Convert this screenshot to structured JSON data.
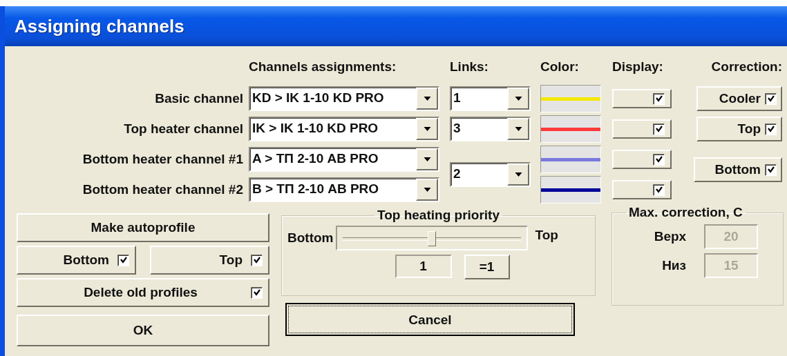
{
  "window": {
    "title": "Assigning channels"
  },
  "headers": {
    "assignments": "Channels assignments:",
    "links": "Links:",
    "colour_column": "Color:",
    "display": "Display:",
    "correction": "Correction:"
  },
  "channels": [
    {
      "label": "Basic channel",
      "assignment": "KD > IK 1-10 KD PRO",
      "color": "#f5e800",
      "display": true
    },
    {
      "label": "Top heater channel",
      "assignment": "IK > IK 1-10 KD PRO",
      "color": "#ff3a3a",
      "display": true
    },
    {
      "label": "Bottom heater channel #1",
      "assignment": "A > ТП 2-10 AB PRO",
      "color": "#7a7ae0",
      "display": true
    },
    {
      "label": "Bottom heater channel #2",
      "assignment": "B > ТП 2-10 AB PRO",
      "color": "#000099",
      "display": true
    }
  ],
  "links": [
    {
      "value": "1"
    },
    {
      "value": "3"
    },
    {
      "value": "2"
    }
  ],
  "correction": [
    {
      "label": "Cooler",
      "checked": true
    },
    {
      "label": "Top",
      "checked": true
    },
    {
      "label": "Bottom",
      "checked": true
    }
  ],
  "autoprofile": {
    "button": "Make autoprofile",
    "options": [
      {
        "label": "Bottom",
        "checked": true
      },
      {
        "label": "Top",
        "checked": true
      }
    ],
    "delete_old": {
      "label": "Delete old profiles",
      "checked": true
    }
  },
  "priority": {
    "title": "Top heating priority",
    "left": "Bottom",
    "right": "Top",
    "level": 0.5,
    "value": "1",
    "reset": "=1"
  },
  "max_correction": {
    "title": "Max. correction, C",
    "fields": [
      {
        "label": "Верх",
        "value": "20",
        "disabled": true
      },
      {
        "label": "Низ",
        "value": "15",
        "disabled": true
      }
    ]
  },
  "buttons": [
    {
      "label": "OK",
      "focused": false
    },
    {
      "label": "Cancel",
      "focused": true
    }
  ]
}
